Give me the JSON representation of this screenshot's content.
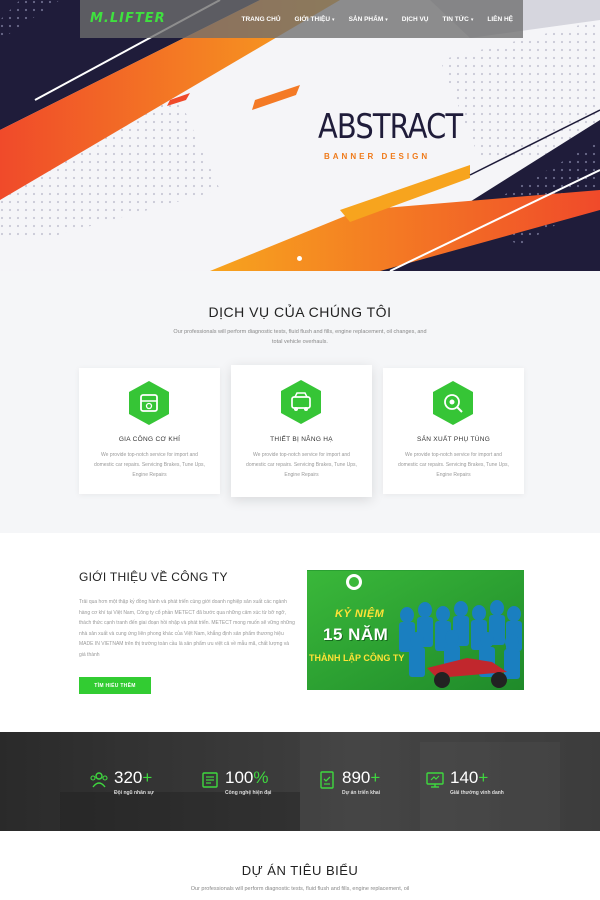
{
  "nav": {
    "logo": "M.LIFTER",
    "items": [
      {
        "label": "TRANG CHỦ",
        "dropdown": false
      },
      {
        "label": "GIỚI THIỆU",
        "dropdown": true
      },
      {
        "label": "SẢN PHẨM",
        "dropdown": true
      },
      {
        "label": "DỊCH VỤ",
        "dropdown": false
      },
      {
        "label": "TIN TỨC",
        "dropdown": true
      },
      {
        "label": "LIÊN HỆ",
        "dropdown": false
      }
    ]
  },
  "hero": {
    "title": "ABSTRACT",
    "subtitle": "BANNER DESIGN"
  },
  "services": {
    "title": "DỊCH VỤ CỦA CHÚNG TÔI",
    "description": "Our professionals will perform diagnostic tests, fluid flush and fills, engine replacement, oil changes, and total vehicle overhauls.",
    "cards": [
      {
        "title": "GIA CÔNG CƠ KHÍ",
        "text": "We provide top-notch service for import and domestic car repairs. Servicing Brakes, Tune Ups, Engine Repairs",
        "icon": "machining-icon"
      },
      {
        "title": "THIẾT BỊ NÂNG HẠ",
        "text": "We provide top-notch service for import and domestic car repairs. Servicing Brakes, Tune Ups, Engine Repairs",
        "icon": "lift-equipment-icon"
      },
      {
        "title": "SẢN XUẤT PHỤ TÙNG",
        "text": "We provide top-notch service for import and domestic car repairs. Servicing Brakes, Tune Ups, Engine Repairs",
        "icon": "spare-parts-icon"
      }
    ]
  },
  "about": {
    "title": "GIỚI THIỆU VỀ CÔNG TY",
    "text": "Trải qua hơn một thập kỷ đồng hành và phát triển cùng giới doanh nghiệp sản xuất các ngành hàng cơ khí tại Việt Nam, Công ty cổ phần METECT đã bước qua những cảm xúc từ bỡ ngỡ, thách thức cạnh tranh đến giai đoạn hồi nhập và phát triển. METECT mong muốn sẽ vững những nhà sản xuất và cung ứng liên phong khác của Việt Nam, khẳng định sản phẩm thương hiệu MADE IN VIETNAM trên thị trường toàn cầu là sản phẩm ưu việt cả về mẫu mã, chất lượng và giá thành",
    "button": "TÌM HIỂU THÊM",
    "image": {
      "line1": "KỶ NIỆM",
      "line2": "15 NĂM",
      "line3": "THÀNH LẬP CÔNG TY"
    }
  },
  "stats": [
    {
      "number": "320",
      "plus": "+",
      "label": "Đội ngũ nhân sự",
      "icon": "team-icon"
    },
    {
      "number": "100",
      "plus": "%",
      "label": "Công nghệ hiện đại",
      "icon": "technology-icon"
    },
    {
      "number": "890",
      "plus": "+",
      "label": "Dự án triển khai",
      "icon": "project-icon"
    },
    {
      "number": "140",
      "plus": "+",
      "label": "Giải thưởng vinh danh",
      "icon": "award-icon"
    }
  ],
  "projects": {
    "title": "DỰ ÁN TIÊU BIỂU",
    "description": "Our professionals will perform diagnostic tests, fluid flush and fills, engine replacement, oil"
  },
  "colors": {
    "accent_green": "#32cc32",
    "navy": "#1f1c3a",
    "orange": "#f28a1e"
  }
}
